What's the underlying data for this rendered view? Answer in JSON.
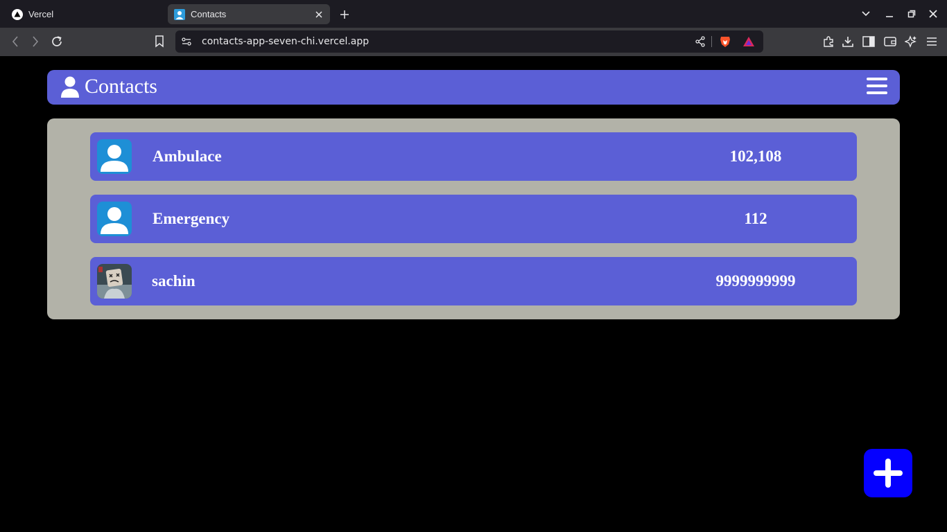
{
  "browser": {
    "tabs": [
      {
        "title": "Vercel",
        "icon": "vercel-logo-icon",
        "active": false
      },
      {
        "title": "Contacts",
        "icon": "contact-icon",
        "active": true
      }
    ],
    "url": "contacts-app-seven-chi.vercel.app"
  },
  "app": {
    "title": "Contacts",
    "accent": "#5b5fd6",
    "panel_color": "#b2b2a8",
    "fab_color": "#0500ff"
  },
  "contacts": [
    {
      "name": "Ambulace",
      "phone": "102,108",
      "avatar": "default-person-icon"
    },
    {
      "name": "Emergency",
      "phone": "112",
      "avatar": "default-person-icon"
    },
    {
      "name": "sachin",
      "phone": "9999999999",
      "avatar": "photo-avatar"
    }
  ]
}
